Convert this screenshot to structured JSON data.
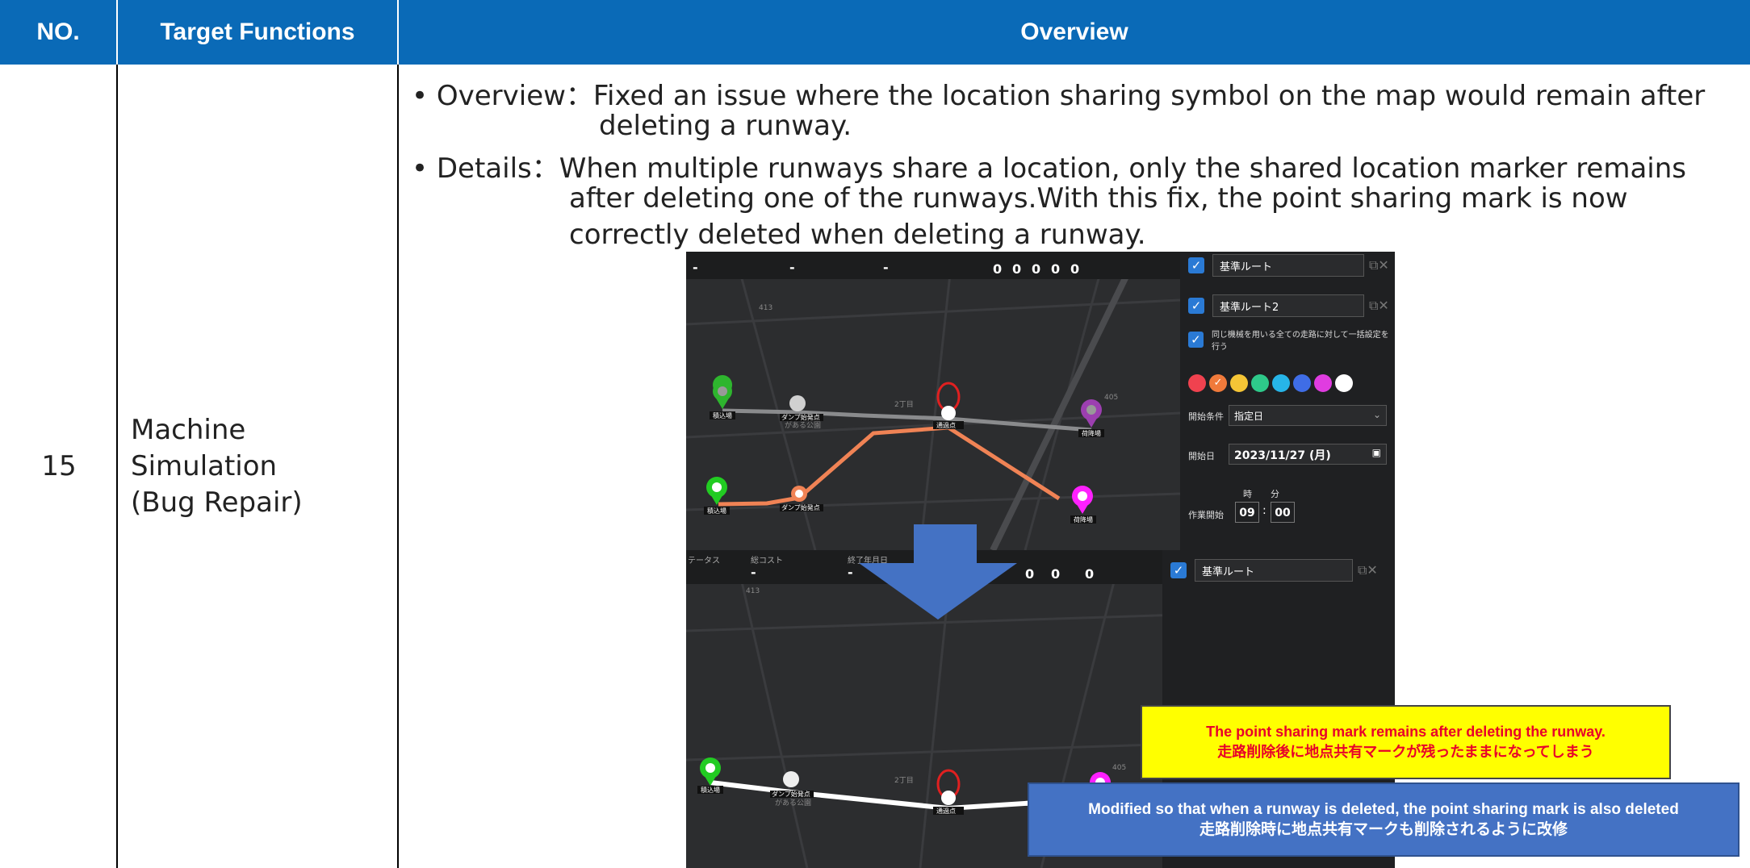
{
  "table": {
    "headers": {
      "no": "NO.",
      "target_functions": "Target Functions",
      "overview": "Overview"
    },
    "row": {
      "no": "15",
      "target_function_lines": [
        "Machine",
        "Simulation",
        "(Bug Repair)"
      ],
      "overview_lines": [
        "• Overview：Fixed an issue where the location sharing symbol on the map would remain after",
        "deleting a runway.",
        "• Details：When multiple runways share a location, only the shared location marker remains",
        "after deleting one of the runways.With this fix, the point sharing mark is now",
        "correctly deleted when deleting a runway."
      ]
    }
  },
  "screenshot": {
    "top_panel": {
      "routes": [
        "基準ルート",
        "基準ルート2"
      ],
      "bulk_setting_label": "同じ機械を用いる全ての走路に対して一括設定を行う",
      "colors": [
        "#f0424f",
        "#f07a3b",
        "#f5c536",
        "#2ec98a",
        "#27b5e8",
        "#3f6de6",
        "#e03ce0",
        "#ffffff"
      ],
      "start_condition_label": "開始条件",
      "start_condition_value": "指定日",
      "start_date_label": "開始日",
      "start_date_value": "2023/11/27 (月)",
      "work_start_label": "作業開始",
      "hour_label": "時",
      "minute_label": "分",
      "hour_value": "09",
      "minute_value": "00",
      "time_sep": ":"
    },
    "top_statbar": {
      "values": [
        "-",
        "-",
        "-"
      ],
      "machine_counts": [
        "0",
        "0",
        "0",
        "0",
        "0"
      ]
    },
    "bottom_statbar": {
      "labels": [
        "テータス",
        "総コスト",
        "終了年月日"
      ],
      "values": [
        "-",
        "-"
      ],
      "machine_counts": [
        "0",
        "0",
        "0",
        "0"
      ]
    },
    "bottom_panel": {
      "routes": [
        "基準ルート"
      ]
    },
    "map_labels": {
      "dump_start": "ダンプ始発点",
      "park": "がある公園",
      "area": "2丁目",
      "pass": "通過点",
      "loading": "積込場",
      "unloading": "荷降場",
      "road_413": "413",
      "road_405": "405"
    }
  },
  "callouts": {
    "yellow": [
      "The point sharing mark remains after deleting the runway.",
      "走路削除後に地点共有マークが残ったままになってしまう"
    ],
    "blue": [
      "Modified so that when a runway is deleted, the point sharing mark is also deleted",
      "走路削除時に地点共有マークも削除されるように改修"
    ]
  }
}
